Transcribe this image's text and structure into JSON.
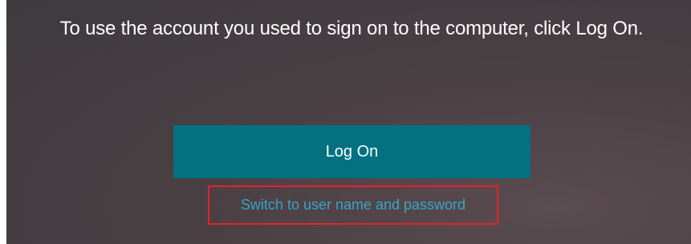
{
  "login": {
    "message": "To use the account you used to sign on to the computer, click Log On.",
    "logon_button_label": "Log On",
    "switch_link_label": "Switch to user name and password"
  },
  "colors": {
    "background": "#433d41",
    "button": "#027181",
    "link": "#3aa4c7",
    "highlight_border": "#e8212b"
  }
}
